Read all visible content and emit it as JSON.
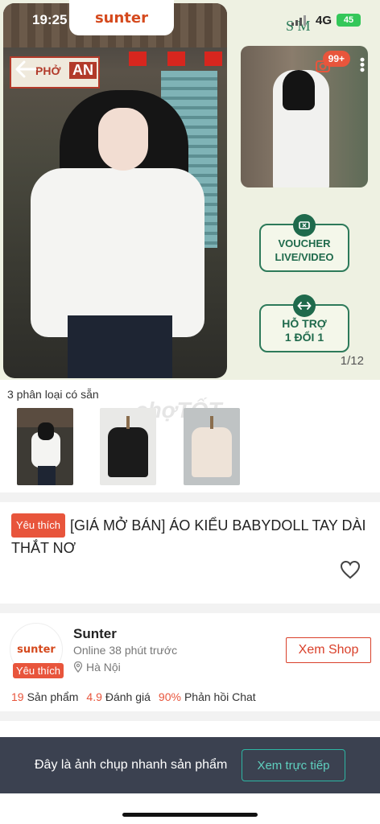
{
  "status_bar": {
    "time": "19:25",
    "network": "4G",
    "battery": "45"
  },
  "brand": {
    "name": "sunter",
    "partner_mark": "S M"
  },
  "gallery": {
    "badge": "99+",
    "counter": "1/12",
    "sign_text_left": "PHỞ",
    "sign_text_right": "AN",
    "buttons": [
      {
        "label_line1": "VOUCHER",
        "label_line2": "LIVE/VIDEO"
      },
      {
        "label_line1": "HỖ TRỢ",
        "label_line2": "1 ĐỔI 1"
      }
    ]
  },
  "variants": {
    "label": "3 phân loại có sẵn",
    "watermark": "chợTỐT"
  },
  "product": {
    "tag": "Yêu thích",
    "title": "[GIÁ MỞ BÁN] ÁO KIỂU BABYDOLL TAY DÀI THẮT NƠ"
  },
  "shop": {
    "logo": "sunter",
    "tag": "Yêu thích",
    "name": "Sunter",
    "online": "Online 38 phút trước",
    "location": "Hà Nội",
    "view_button": "Xem Shop",
    "stats": [
      {
        "value": "19",
        "label": "Sản phẩm"
      },
      {
        "value": "4.9",
        "label": "Đánh giá"
      },
      {
        "value": "90%",
        "label": "Phản hồi Chat"
      }
    ]
  },
  "snapshot_banner": {
    "message": "Đây là ảnh chụp nhanh sản phẩm",
    "button": "Xem trực tiếp"
  },
  "colors": {
    "accent": "#e8553c",
    "green": "#1f6a4c",
    "banner": "#3b4150"
  }
}
